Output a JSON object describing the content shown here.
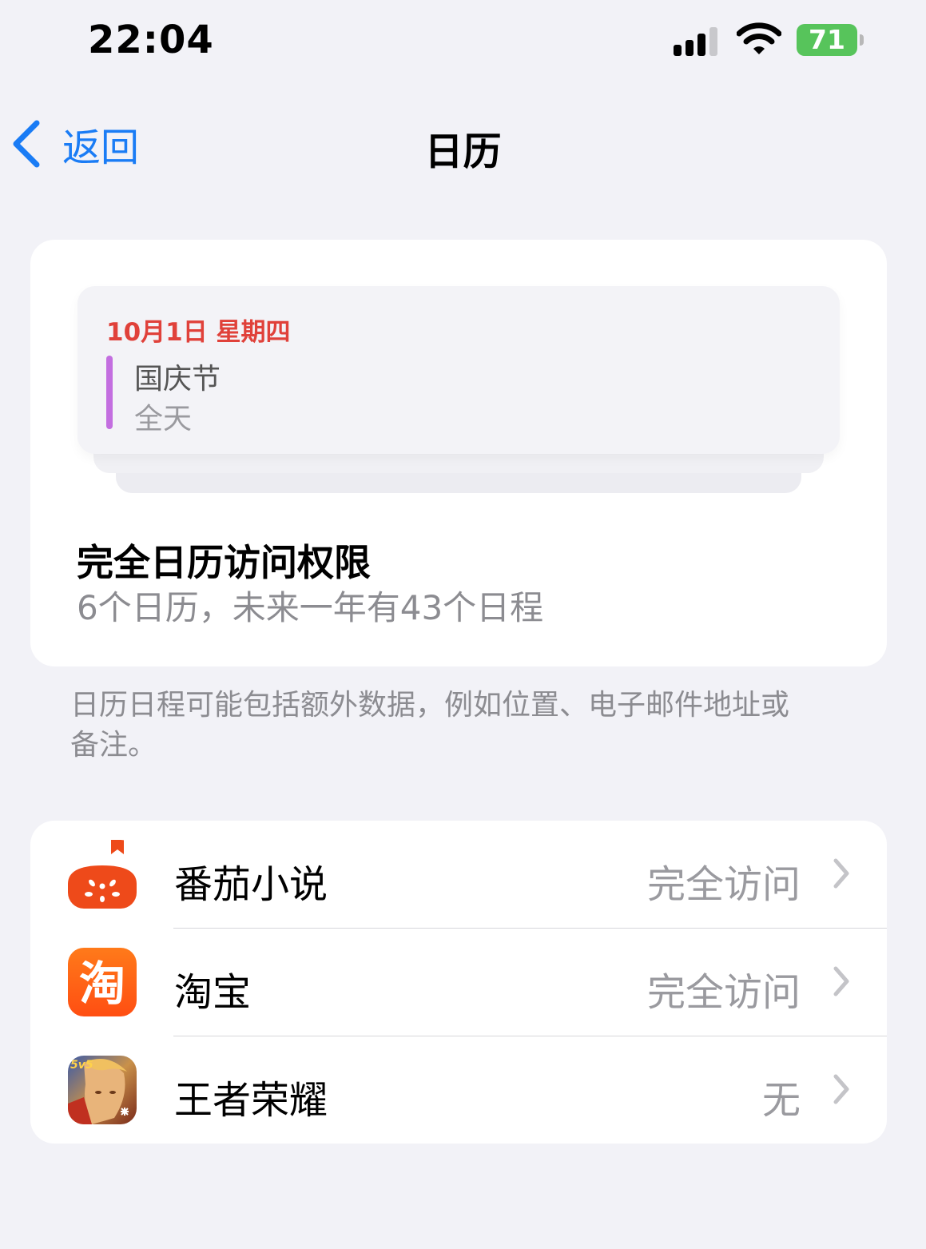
{
  "status_bar": {
    "time": "22:04",
    "battery": "71"
  },
  "nav": {
    "back_label": "返回",
    "title": "日历"
  },
  "event_card": {
    "date": "10月1日 星期四",
    "name": "国庆节",
    "time": "全天"
  },
  "permission": {
    "title": "完全日历访问权限",
    "subtitle": "6个日历，未来一年有43个日程"
  },
  "footnote": "日历日程可能包括额外数据，例如位置、电子邮件地址或备注。",
  "apps": [
    {
      "name": "番茄小说",
      "access": "完全访问",
      "icon": "fanqie-novel-icon"
    },
    {
      "name": "淘宝",
      "access": "完全访问",
      "icon": "taobao-icon"
    },
    {
      "name": "王者荣耀",
      "access": "无",
      "icon": "honor-of-kings-icon"
    }
  ],
  "colors": {
    "accent": "#1a7cf5",
    "date_red": "#e0413a",
    "event_bar": "#c36ee0",
    "battery_green": "#57c45b"
  }
}
